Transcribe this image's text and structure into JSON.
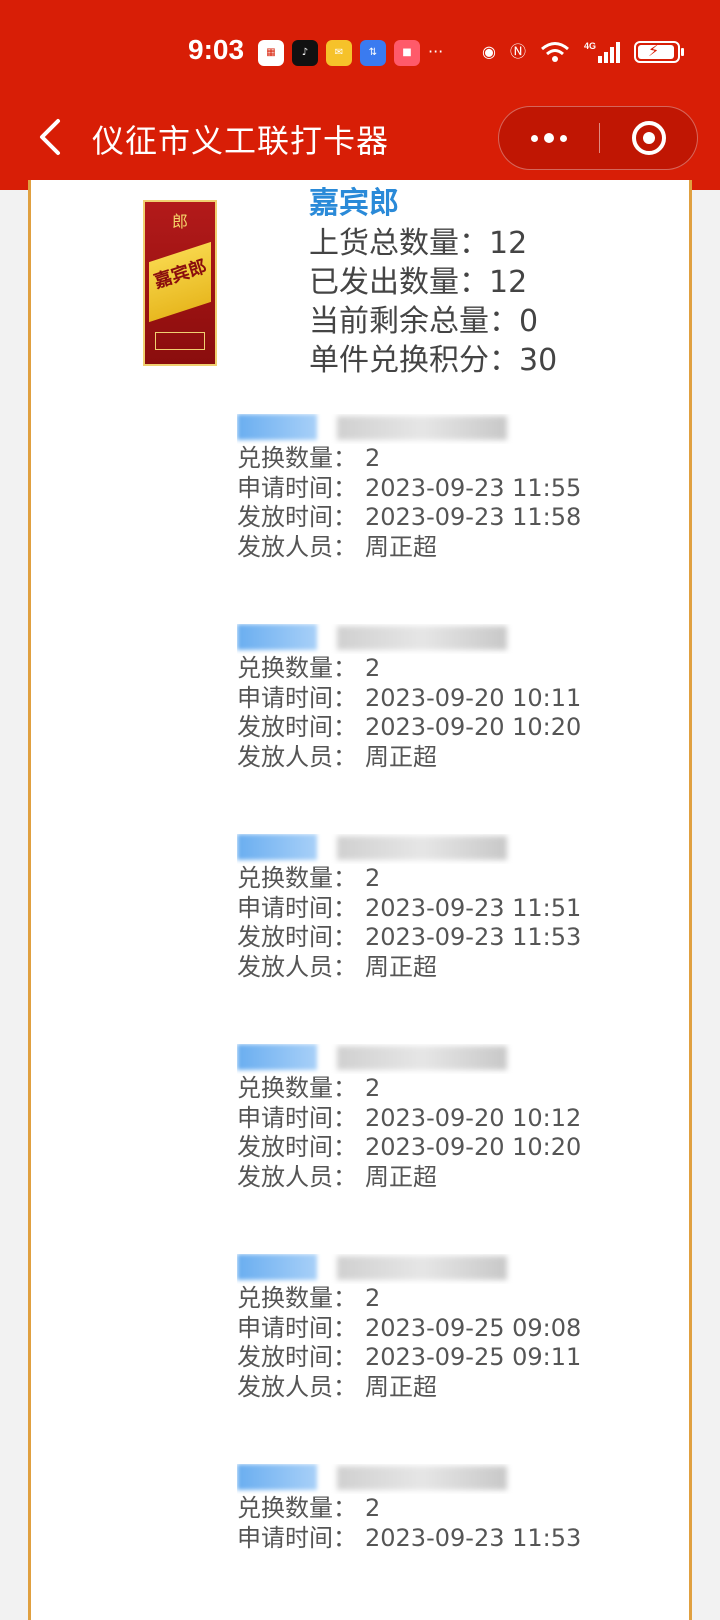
{
  "status_bar": {
    "time": "9:03",
    "network": "4G"
  },
  "nav": {
    "title": "仪征市义工联打卡器"
  },
  "product": {
    "name": "嘉宾郎",
    "image_text_top": "郎",
    "image_text_name": "嘉宾郎",
    "stats": [
      {
        "label": "上货总数量：",
        "value": "12"
      },
      {
        "label": "已发出数量：",
        "value": "12"
      },
      {
        "label": "当前剩余总量：",
        "value": "0"
      },
      {
        "label": "单件兑换积分：",
        "value": "30"
      }
    ]
  },
  "labels": {
    "qty": "兑换数量：",
    "apply_time": "申请时间：",
    "issue_time": "发放时间：",
    "issuer": "发放人员："
  },
  "records": [
    {
      "qty": "2",
      "apply_time": "2023-09-23 11:55",
      "issue_time": "2023-09-23 11:58",
      "issuer": "周正超"
    },
    {
      "qty": "2",
      "apply_time": "2023-09-20 10:11",
      "issue_time": "2023-09-20 10:20",
      "issuer": "周正超"
    },
    {
      "qty": "2",
      "apply_time": "2023-09-23 11:51",
      "issue_time": "2023-09-23 11:53",
      "issuer": "周正超"
    },
    {
      "qty": "2",
      "apply_time": "2023-09-20 10:12",
      "issue_time": "2023-09-20 10:20",
      "issuer": "周正超"
    },
    {
      "qty": "2",
      "apply_time": "2023-09-25 09:08",
      "issue_time": "2023-09-25 09:11",
      "issuer": "周正超"
    },
    {
      "qty": "2",
      "apply_time": "2023-09-23 11:53",
      "issue_time": "",
      "issuer": ""
    }
  ],
  "colors": {
    "header_bg": "#d81e06",
    "accent_blue": "#2a8ad8",
    "card_border": "#e0a040"
  }
}
